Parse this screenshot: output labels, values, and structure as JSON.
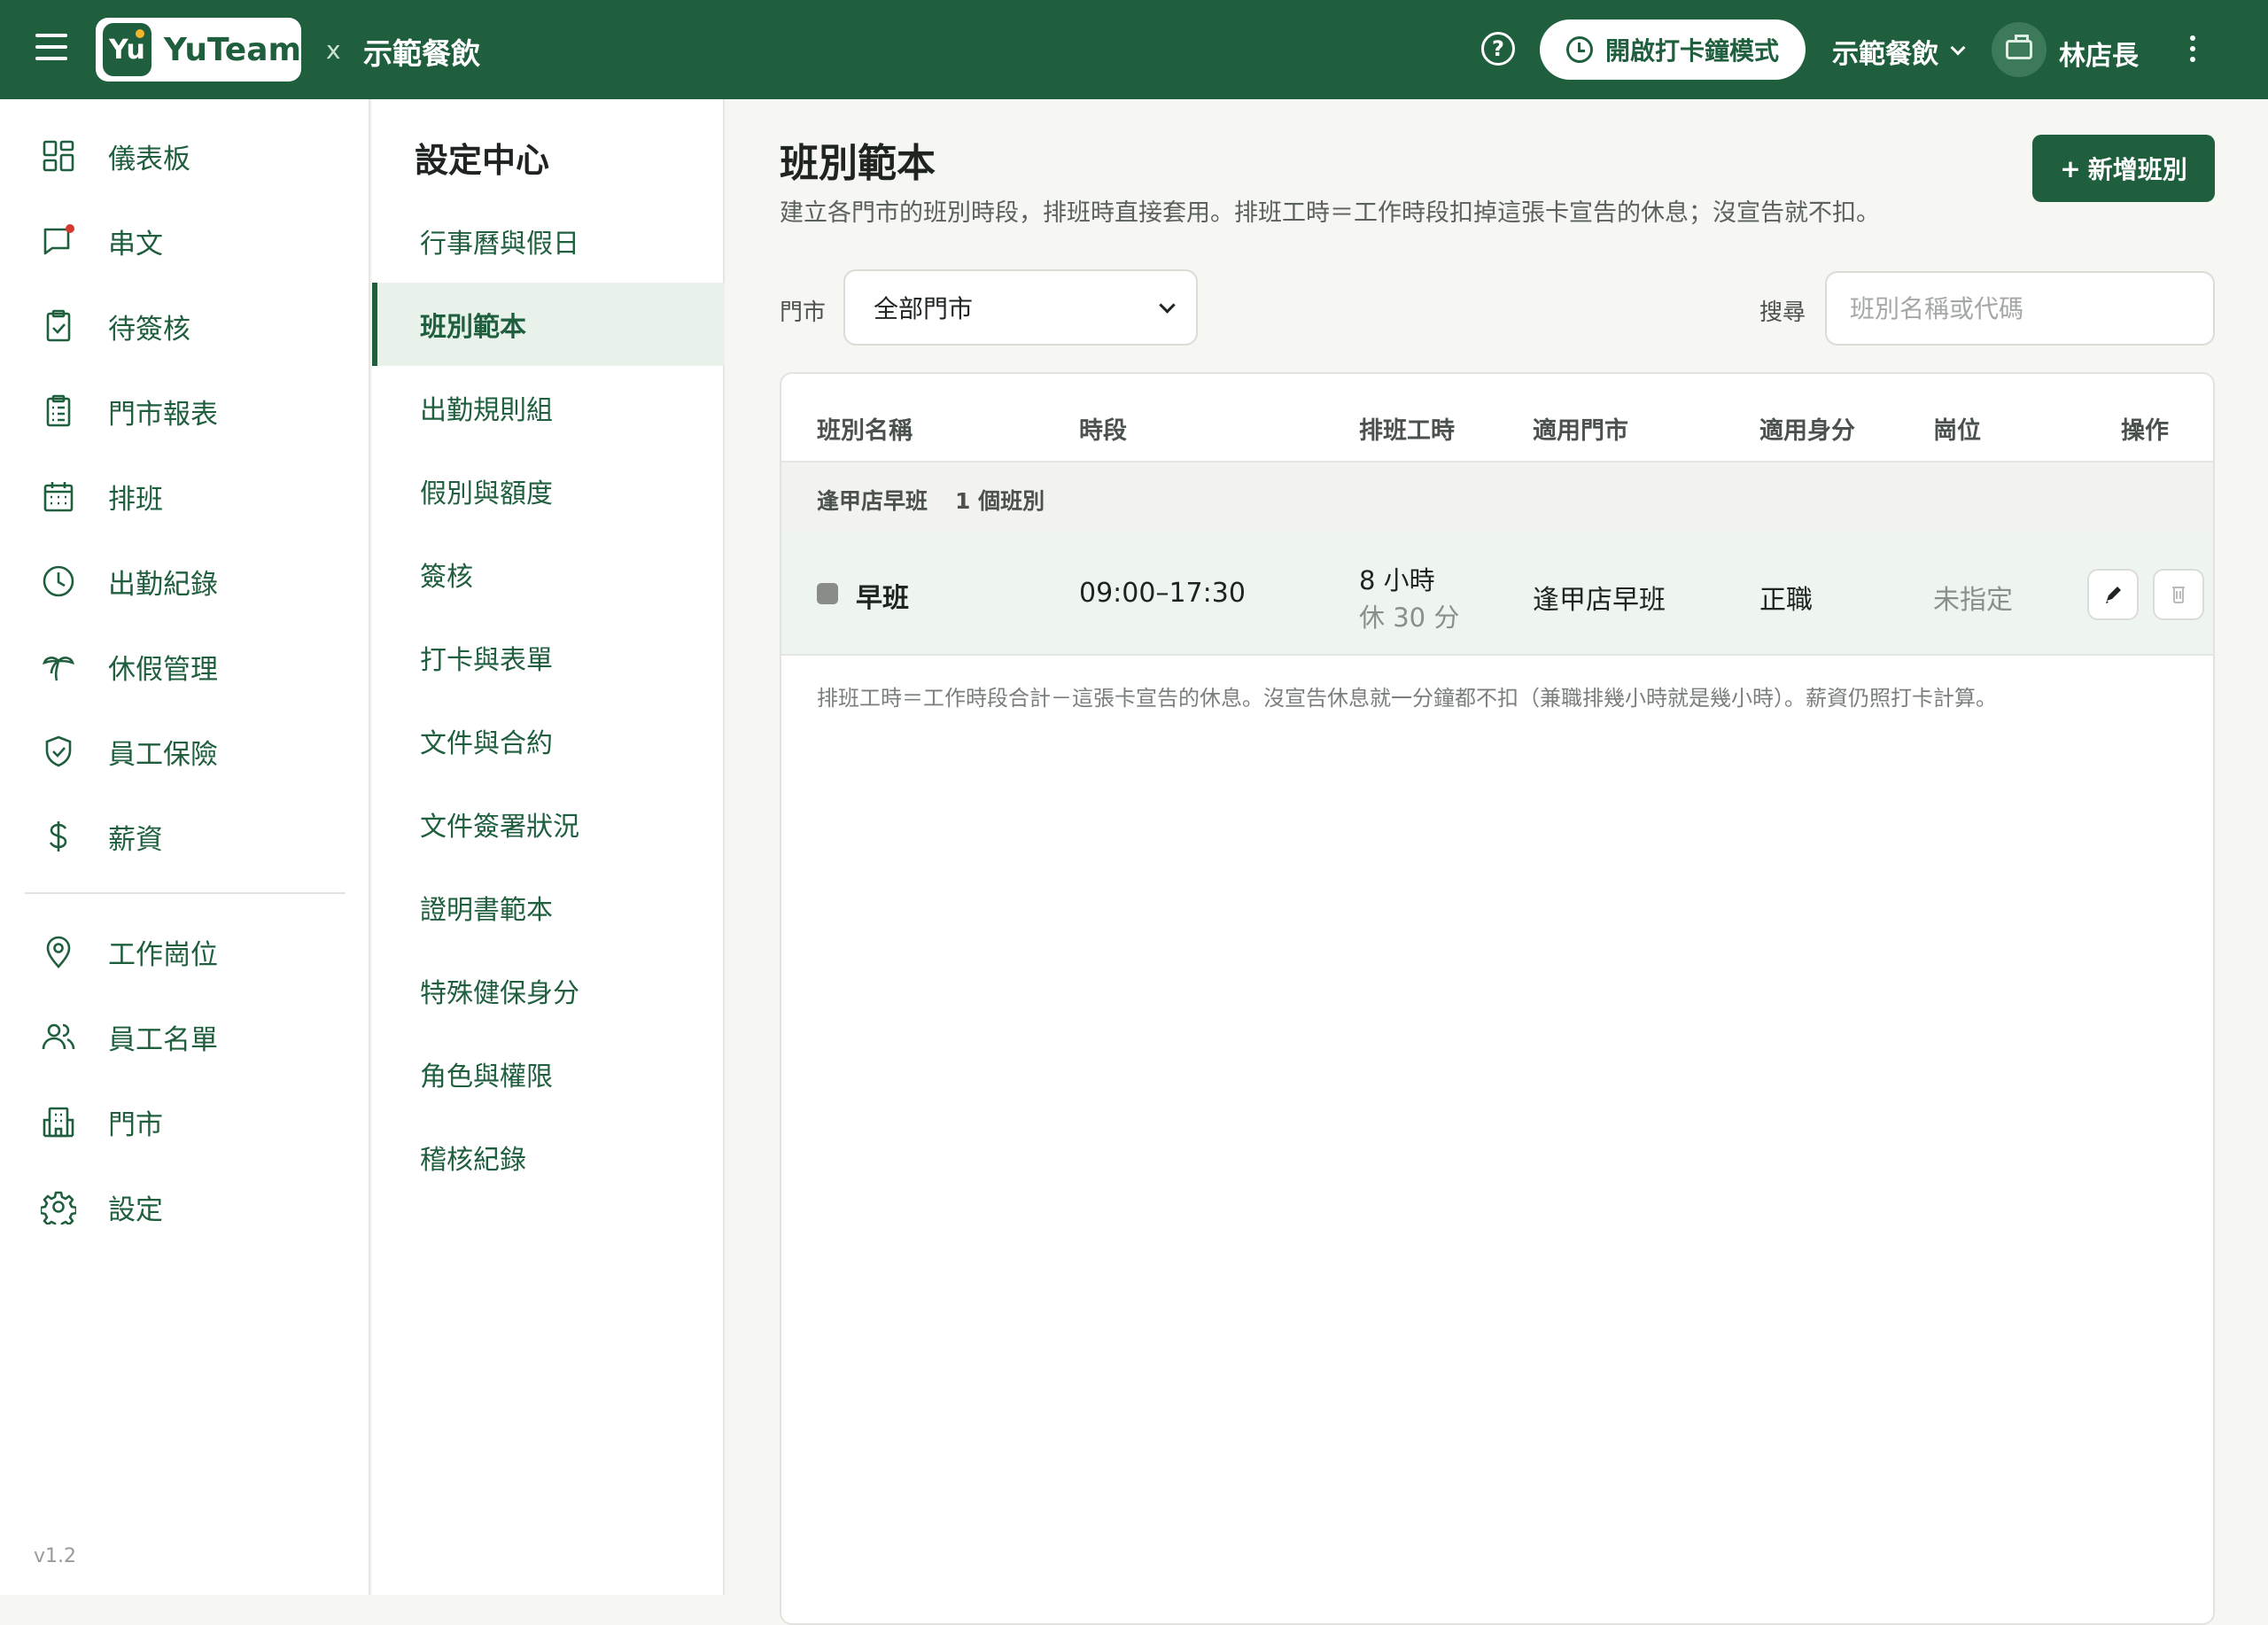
{
  "header": {
    "brand_mark": "Yu",
    "brand_name": "YuTeam",
    "separator": "x",
    "org_name": "示範餐飲",
    "help_glyph": "?",
    "clock_button_label": "開啟打卡鐘模式",
    "org_selector_label": "示範餐飲",
    "user_name": "林店長"
  },
  "sidebar": {
    "items": [
      {
        "label": "儀表板",
        "icon": "dashboard-icon"
      },
      {
        "label": "串文",
        "icon": "chat-icon"
      },
      {
        "label": "待簽核",
        "icon": "clipboard-check-icon"
      },
      {
        "label": "門市報表",
        "icon": "report-icon"
      },
      {
        "label": "排班",
        "icon": "calendar-icon"
      },
      {
        "label": "出勤紀錄",
        "icon": "clock-icon"
      },
      {
        "label": "休假管理",
        "icon": "palm-tree-icon"
      },
      {
        "label": "員工保險",
        "icon": "shield-check-icon"
      },
      {
        "label": "薪資",
        "icon": "dollar-icon"
      },
      {
        "label": "工作崗位",
        "icon": "location-pin-icon"
      },
      {
        "label": "員工名單",
        "icon": "users-icon"
      },
      {
        "label": "門市",
        "icon": "building-icon"
      },
      {
        "label": "設定",
        "icon": "gear-icon"
      }
    ],
    "version": "v1.2"
  },
  "settings": {
    "title": "設定中心",
    "items": [
      {
        "label": "行事曆與假日"
      },
      {
        "label": "班別範本",
        "active": true
      },
      {
        "label": "出勤規則組"
      },
      {
        "label": "假別與額度"
      },
      {
        "label": "簽核"
      },
      {
        "label": "打卡與表單"
      },
      {
        "label": "文件與合約"
      },
      {
        "label": "文件簽署狀況"
      },
      {
        "label": "證明書範本"
      },
      {
        "label": "特殊健保身分"
      },
      {
        "label": "角色與權限"
      },
      {
        "label": "稽核紀錄"
      }
    ]
  },
  "main": {
    "title": "班別範本",
    "description": "建立各門市的班別時段，排班時直接套用。排班工時＝工作時段扣掉這張卡宣告的休息；沒宣告就不扣。",
    "add_button": "新增班別",
    "filter": {
      "store_label": "門市",
      "store_value": "全部門市",
      "search_label": "搜尋",
      "search_placeholder": "班別名稱或代碼",
      "search_value": ""
    },
    "table": {
      "columns": [
        "班別名稱",
        "時段",
        "排班工時",
        "適用門市",
        "適用身分",
        "崗位",
        "操作"
      ],
      "groups": [
        {
          "name": "逢甲店早班",
          "count": "1 個班別",
          "rows": [
            {
              "color": "#8a8c8a",
              "name": "早班",
              "time": "09:00–17:30",
              "hours": "8 小時",
              "break": "休 30 分",
              "store": "逢甲店早班",
              "identity": "正職",
              "position": "未指定"
            }
          ]
        }
      ],
      "footnote": "排班工時＝工作時段合計－這張卡宣告的休息。沒宣告休息就一分鐘都不扣（兼職排幾小時就是幾小時）。薪資仍照打卡計算。"
    }
  },
  "colors": {
    "brand_green": "#1f5f3e",
    "accent_yellow": "#f2b62b",
    "notification_red": "#d63a2f"
  }
}
